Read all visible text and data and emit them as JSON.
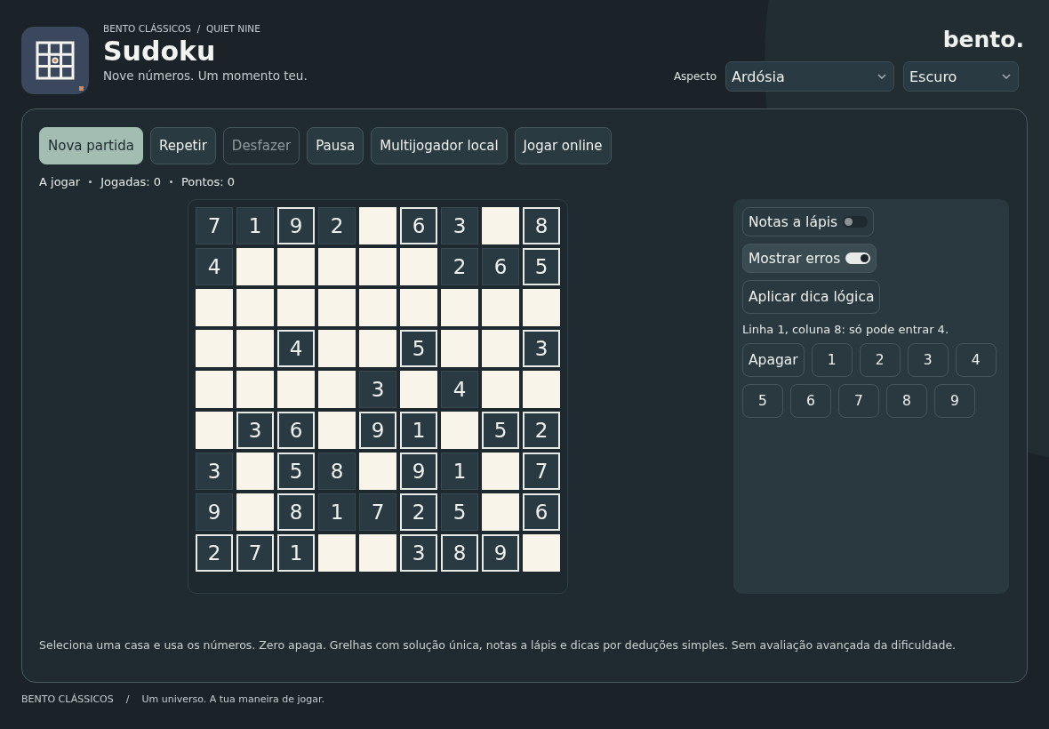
{
  "header": {
    "breadcrumb": "BENTO CLÁSSICOS  /  QUIET NINE",
    "title": "Sudoku",
    "subtitle": "Nove números. Um momento teu.",
    "brand": "bento.",
    "aspect_label": "Aspecto",
    "selects": [
      {
        "value": "Ardósia"
      },
      {
        "value": "Escuro"
      }
    ]
  },
  "toolbar": [
    {
      "label": "Nova partida",
      "primary": true,
      "disabled": false
    },
    {
      "label": "Repetir",
      "primary": false,
      "disabled": false
    },
    {
      "label": "Desfazer",
      "primary": false,
      "disabled": true
    },
    {
      "label": "Pausa",
      "primary": false,
      "disabled": false
    },
    {
      "label": "Multijogador local",
      "primary": false,
      "disabled": false
    },
    {
      "label": "Jogar online",
      "primary": false,
      "disabled": false
    }
  ],
  "status": [
    "A jogar",
    "Jogadas: 0",
    "Pontos: 0"
  ],
  "board": [
    [
      {
        "value": "7",
        "outlined": false
      },
      {
        "value": "1",
        "outlined": false
      },
      {
        "value": "9",
        "outlined": true
      },
      {
        "value": "2",
        "outlined": false
      },
      {
        "outlined": false
      },
      {
        "value": "6",
        "outlined": true
      },
      {
        "value": "3",
        "outlined": false
      },
      {
        "outlined": false
      },
      {
        "value": "8",
        "outlined": true
      }
    ],
    [
      {
        "value": "4",
        "outlined": false
      },
      {
        "outlined": false
      },
      {
        "outlined": false
      },
      {
        "outlined": false
      },
      {
        "outlined": false
      },
      {
        "outlined": false
      },
      {
        "value": "2",
        "outlined": false
      },
      {
        "value": "6",
        "outlined": false
      },
      {
        "value": "5",
        "outlined": true
      }
    ],
    [
      {
        "outlined": false
      },
      {
        "outlined": false
      },
      {
        "outlined": false
      },
      {
        "outlined": false
      },
      {
        "outlined": false
      },
      {
        "outlined": false
      },
      {
        "outlined": false
      },
      {
        "outlined": false
      },
      {
        "outlined": false
      }
    ],
    [
      {
        "outlined": false
      },
      {
        "outlined": false
      },
      {
        "value": "4",
        "outlined": true
      },
      {
        "outlined": false
      },
      {
        "outlined": false
      },
      {
        "value": "5",
        "outlined": true
      },
      {
        "outlined": false
      },
      {
        "outlined": false
      },
      {
        "value": "3",
        "outlined": true
      }
    ],
    [
      {
        "outlined": false
      },
      {
        "outlined": false
      },
      {
        "outlined": false
      },
      {
        "outlined": false
      },
      {
        "value": "3",
        "outlined": false
      },
      {
        "outlined": false
      },
      {
        "value": "4",
        "outlined": false
      },
      {
        "outlined": false
      },
      {
        "outlined": false
      }
    ],
    [
      {
        "outlined": false
      },
      {
        "value": "3",
        "outlined": true
      },
      {
        "value": "6",
        "outlined": true
      },
      {
        "outlined": false
      },
      {
        "value": "9",
        "outlined": true
      },
      {
        "value": "1",
        "outlined": true
      },
      {
        "outlined": false
      },
      {
        "value": "5",
        "outlined": true
      },
      {
        "value": "2",
        "outlined": true
      }
    ],
    [
      {
        "value": "3",
        "outlined": false
      },
      {
        "outlined": false
      },
      {
        "value": "5",
        "outlined": true
      },
      {
        "value": "8",
        "outlined": false
      },
      {
        "outlined": false
      },
      {
        "value": "9",
        "outlined": true
      },
      {
        "value": "1",
        "outlined": false
      },
      {
        "outlined": false
      },
      {
        "value": "7",
        "outlined": true
      }
    ],
    [
      {
        "value": "9",
        "outlined": false
      },
      {
        "outlined": false
      },
      {
        "value": "8",
        "outlined": true
      },
      {
        "value": "1",
        "outlined": false
      },
      {
        "value": "7",
        "outlined": false
      },
      {
        "value": "2",
        "outlined": true
      },
      {
        "value": "5",
        "outlined": false
      },
      {
        "outlined": false
      },
      {
        "value": "6",
        "outlined": true
      }
    ],
    [
      {
        "value": "2",
        "outlined": true
      },
      {
        "value": "7",
        "outlined": true
      },
      {
        "value": "1",
        "outlined": true
      },
      {
        "outlined": false
      },
      {
        "outlined": false
      },
      {
        "value": "3",
        "outlined": true
      },
      {
        "value": "8",
        "outlined": true
      },
      {
        "value": "9",
        "outlined": true
      },
      {
        "outlined": false
      }
    ]
  ],
  "side": {
    "toggles": [
      {
        "label": "Notas a lápis",
        "on": false
      },
      {
        "label": "Mostrar erros",
        "on": true
      }
    ],
    "hint_button": "Aplicar dica lógica",
    "hint": "Linha 1, coluna 8: só pode entrar 4.",
    "keys": [
      "Apagar",
      "1",
      "2",
      "3",
      "4",
      "5",
      "6",
      "7",
      "8",
      "9"
    ]
  },
  "footnote": "Seleciona uma casa e usa os números. Zero apaga. Grelhas com solução única, notas a lápis e dicas por deduções simples. Sem avaliação avançada da dificuldade.",
  "footer": [
    "BENTO CLÁSSICOS",
    "/",
    "Um universo. A tua maneira de jogar."
  ]
}
